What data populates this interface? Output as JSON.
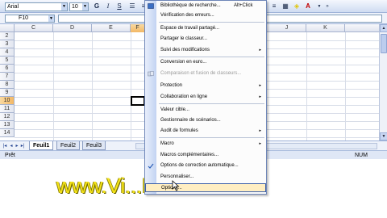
{
  "toolbar": {
    "font_name": "Arial",
    "font_size": "10",
    "bold_label": "G",
    "font_color_label": "A"
  },
  "formula_bar": {
    "name_box": "F10",
    "formula": ""
  },
  "grid": {
    "columns": [
      "C",
      "D",
      "E",
      "F",
      "J",
      "K"
    ],
    "rows": [
      "2",
      "3",
      "4",
      "5",
      "6",
      "7",
      "8",
      "9",
      "10",
      "11",
      "12",
      "13",
      "14"
    ],
    "active_cell": "F10"
  },
  "sheet_tabs": {
    "tabs": [
      "Feuil1",
      "Feuil2",
      "Feuil3"
    ],
    "active": "Feuil1",
    "nav_first": "|◂",
    "nav_prev": "◂",
    "nav_next": "▸",
    "nav_last": "▸|"
  },
  "status_bar": {
    "left": "Prêt",
    "num": "NUM"
  },
  "watermark": {
    "text": "www.Vi...Formation.fr"
  },
  "tools_menu": {
    "items": [
      {
        "label": "Bibliothèque de recherche...",
        "shortcut": "Alt+Click"
      },
      {
        "label": "Vérification des erreurs..."
      },
      {
        "label": "Espace de travail partagé..."
      },
      {
        "label": "Partager le classeur..."
      },
      {
        "label": "Suivi des modifications"
      },
      {
        "label": "Conversion en euro..."
      },
      {
        "label": "Comparaison et fusion de classeurs..."
      },
      {
        "label": "Protection"
      },
      {
        "label": "Collaboration en ligne"
      },
      {
        "label": "Valeur cible..."
      },
      {
        "label": "Gestionnaire de scénarios..."
      },
      {
        "label": "Audit de formules"
      },
      {
        "label": "Macro"
      },
      {
        "label": "Macros complémentaires..."
      },
      {
        "label": "Options de correction automatique..."
      },
      {
        "label": "Personnaliser..."
      },
      {
        "label": "Options..."
      }
    ]
  },
  "colors": {
    "menu_highlight": "#ffeec2",
    "watermark": "#f5e419",
    "active_header": "#f3b865"
  }
}
